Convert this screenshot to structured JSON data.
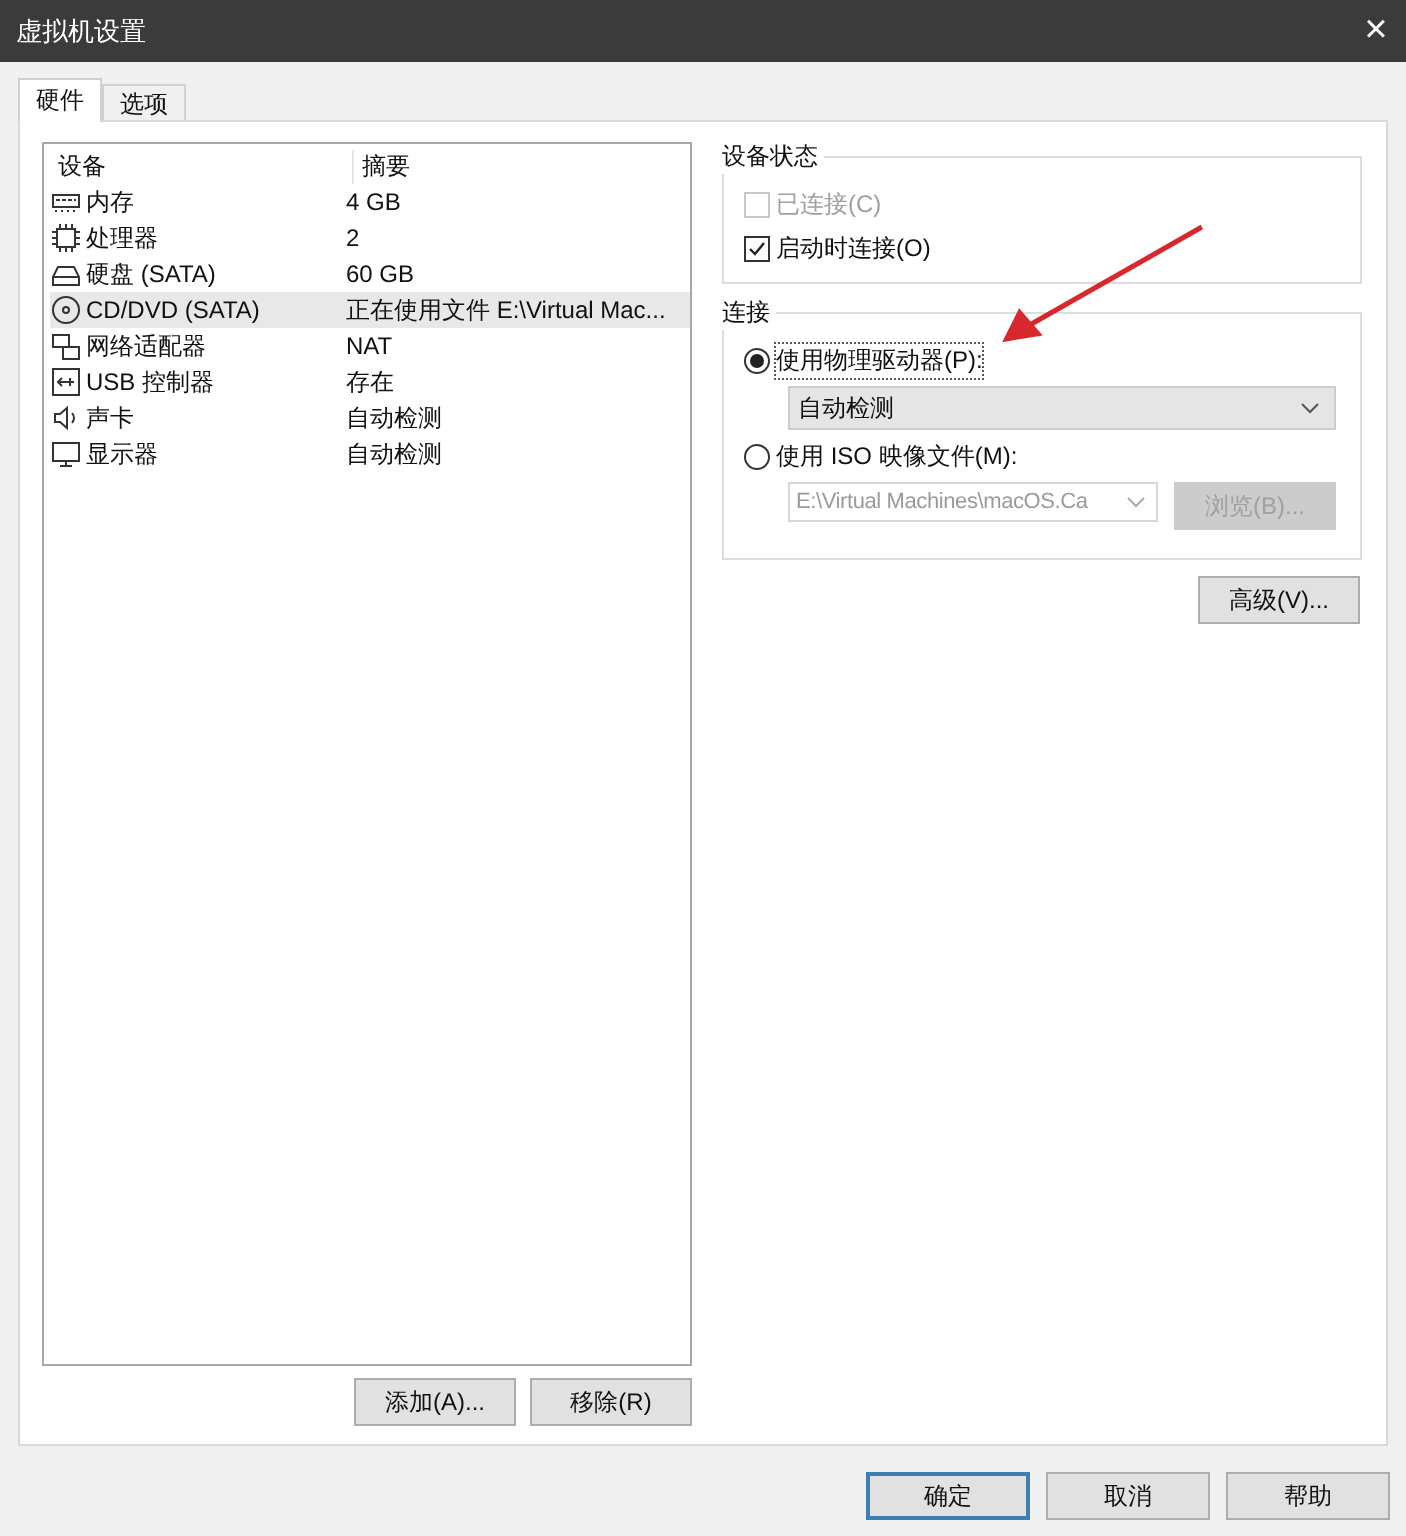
{
  "window": {
    "title": "虚拟机设置",
    "close": "×"
  },
  "tabs": [
    {
      "label": "硬件",
      "selected": true
    },
    {
      "label": "选项",
      "selected": false
    }
  ],
  "device_list": {
    "columns": [
      "设备",
      "摘要"
    ],
    "rows": [
      {
        "device": "内存",
        "summary": "4 GB",
        "selected": false
      },
      {
        "device": "处理器",
        "summary": "2",
        "selected": false
      },
      {
        "device": "硬盘 (SATA)",
        "summary": "60 GB",
        "selected": false
      },
      {
        "device": "CD/DVD (SATA)",
        "summary": "正在使用文件 E:\\Virtual Mac...",
        "selected": true
      },
      {
        "device": "网络适配器",
        "summary": "NAT",
        "selected": false
      },
      {
        "device": "USB 控制器",
        "summary": "存在",
        "selected": false
      },
      {
        "device": "声卡",
        "summary": "自动检测",
        "selected": false
      },
      {
        "device": "显示器",
        "summary": "自动检测",
        "selected": false
      }
    ]
  },
  "list_buttons": [
    "添加(A)...",
    "移除(R)"
  ],
  "device_status": {
    "title": "设备状态",
    "options": [
      {
        "label": "已连接(C)",
        "checked": false,
        "disabled": true
      },
      {
        "label": "启动时连接(O)",
        "checked": true,
        "disabled": false
      }
    ]
  },
  "connection": {
    "title": "连接",
    "physical": {
      "label": "使用物理驱动器(P):",
      "selected": true,
      "dropdown": "自动检测"
    },
    "iso": {
      "label": "使用 ISO 映像文件(M):",
      "selected": false,
      "path": "E:\\Virtual Machines\\macOS.Ca",
      "browse": "浏览(B)..."
    }
  },
  "advanced_button": "高级(V)...",
  "dialog_buttons": [
    "确定",
    "取消",
    "帮助"
  ]
}
